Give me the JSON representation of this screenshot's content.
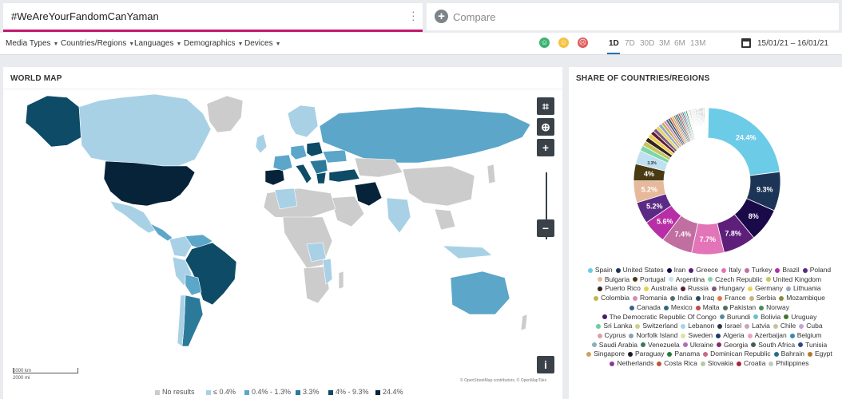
{
  "query": {
    "text": "#WeAreYourFandomCanYaman"
  },
  "compare": {
    "label": "Compare"
  },
  "filters": [
    {
      "label": "Media Types"
    },
    {
      "label": "Countries/Regions"
    },
    {
      "label": "Languages"
    },
    {
      "label": "Demographics"
    },
    {
      "label": "Devices"
    }
  ],
  "sentiments": [
    {
      "name": "positive",
      "color": "#3cb371",
      "glyph": "☺"
    },
    {
      "name": "neutral",
      "color": "#f5c242",
      "glyph": "☺"
    },
    {
      "name": "negative",
      "color": "#e05a5a",
      "glyph": "☹"
    }
  ],
  "ranges": [
    "1D",
    "7D",
    "30D",
    "3M",
    "6M",
    "13M"
  ],
  "active_range": "1D",
  "date_range": "15/01/21 – 16/01/21",
  "world_map": {
    "title": "WORLD MAP",
    "scale_km": "5000 km",
    "scale_mi": "2000 mi",
    "attribution": "© OpenStreetMap contributors, © OpenMapTiles",
    "legend": [
      {
        "label": "No results",
        "color": "#cccccc"
      },
      {
        "label": "≤ 0.4%",
        "color": "#a8d1e6"
      },
      {
        "label": "0.4% - 1.3%",
        "color": "#5ba6c9"
      },
      {
        "label": "3.3%",
        "color": "#2b7a9a"
      },
      {
        "label": "4% - 9.3%",
        "color": "#0d4b66"
      },
      {
        "label": "24.4%",
        "color": "#06233a"
      }
    ]
  },
  "share": {
    "title": "SHARE OF COUNTRIES/REGIONS"
  },
  "chart_data": {
    "type": "pie",
    "title": "SHARE OF COUNTRIES/REGIONS",
    "donut": true,
    "series": [
      {
        "name": "Spain",
        "value": 24.4,
        "label": "24.4%",
        "color": "#6ccbe7"
      },
      {
        "name": "United States",
        "value": 9.3,
        "label": "9.3%",
        "color": "#1c3557"
      },
      {
        "name": "Iran",
        "value": 8,
        "label": "8%",
        "color": "#1a0a4a"
      },
      {
        "name": "Greece",
        "value": 7.8,
        "label": "7.8%",
        "color": "#5e1f7a"
      },
      {
        "name": "Italy",
        "value": 7.7,
        "label": "7.7%",
        "color": "#e374b8"
      },
      {
        "name": "Turkey",
        "value": 7.4,
        "label": "7.4%",
        "color": "#c06fa0"
      },
      {
        "name": "Brazil",
        "value": 5.6,
        "label": "5.6%",
        "color": "#b82ea6"
      },
      {
        "name": "Poland",
        "value": 5.2,
        "label": "5.2%",
        "color": "#5b2a85"
      },
      {
        "name": "Bulgaria",
        "value": 5.2,
        "label": "5.2%",
        "color": "#e6b99a"
      },
      {
        "name": "Portugal",
        "value": 4,
        "label": "4%",
        "color": "#4a3a14"
      },
      {
        "name": "Argentina",
        "value": 3.3,
        "label": "3.3%",
        "color": "#bfe0f0"
      },
      {
        "name": "Czech Republic",
        "value": 1.3,
        "label": "",
        "color": "#7ed6a8"
      },
      {
        "name": "United Kingdom",
        "value": 1.2,
        "label": "",
        "color": "#c2c760"
      },
      {
        "name": "Puerto Rico",
        "value": 1.1,
        "label": "",
        "color": "#37231a"
      },
      {
        "name": "Australia",
        "value": 1,
        "label": "",
        "color": "#e8d04a"
      },
      {
        "name": "Russia",
        "value": 0.9,
        "label": "",
        "color": "#5f1c38"
      },
      {
        "name": "Hungary",
        "value": 0.9,
        "label": "",
        "color": "#7a5a7a"
      },
      {
        "name": "Germany",
        "value": 0.8,
        "label": "",
        "color": "#e6d35a"
      },
      {
        "name": "Lithuania",
        "value": 0.8,
        "label": "",
        "color": "#9aa6c8"
      },
      {
        "name": "Colombia",
        "value": 0.7,
        "label": "",
        "color": "#c3b54a"
      },
      {
        "name": "Romania",
        "value": 0.6,
        "label": "",
        "color": "#d88ab8"
      },
      {
        "name": "India",
        "value": 0.6,
        "label": "",
        "color": "#566b75"
      },
      {
        "name": "Iraq",
        "value": 0.5,
        "label": "",
        "color": "#2a4a66"
      },
      {
        "name": "France",
        "value": 0.5,
        "label": "",
        "color": "#e8734a"
      },
      {
        "name": "Serbia",
        "value": 0.5,
        "label": "",
        "color": "#c8b27a"
      },
      {
        "name": "Mozambique",
        "value": 0.4,
        "label": "",
        "color": "#8a8a3a"
      },
      {
        "name": "Canada",
        "value": 0.4,
        "label": "",
        "color": "#3b5f8a"
      },
      {
        "name": "Mexico",
        "value": 0.4,
        "label": "",
        "color": "#2f6a7a"
      },
      {
        "name": "Malta",
        "value": 0.4,
        "label": "",
        "color": "#c24a4a"
      },
      {
        "name": "Pakistan",
        "value": 0.3,
        "label": "",
        "color": "#4e6e5a"
      },
      {
        "name": "Norway",
        "value": 0.3,
        "label": "",
        "color": "#4a8a5a"
      },
      {
        "name": "The Democratic Republic Of Congo",
        "value": 0.3,
        "label": "",
        "color": "#4a1a6a"
      },
      {
        "name": "Burundi",
        "value": 0.3,
        "label": "",
        "color": "#5a8aa0"
      },
      {
        "name": "Bolivia",
        "value": 0.3,
        "label": "",
        "color": "#6ac0c8"
      },
      {
        "name": "Uruguay",
        "value": 0.3,
        "label": "",
        "color": "#3a7a2a"
      },
      {
        "name": "Sri Lanka",
        "value": 0.2,
        "label": "",
        "color": "#6acf9a"
      },
      {
        "name": "Switzerland",
        "value": 0.2,
        "label": "",
        "color": "#c8d08a"
      },
      {
        "name": "Lebanon",
        "value": 0.2,
        "label": "",
        "color": "#a0d8e0"
      },
      {
        "name": "Israel",
        "value": 0.2,
        "label": "",
        "color": "#2a3a4a"
      },
      {
        "name": "Latvia",
        "value": 0.2,
        "label": "",
        "color": "#c8a0c0"
      },
      {
        "name": "Chile",
        "value": 0.2,
        "label": "",
        "color": "#c8c0a0"
      },
      {
        "name": "Cuba",
        "value": 0.2,
        "label": "",
        "color": "#c8a0d8"
      },
      {
        "name": "Cyprus",
        "value": 0.2,
        "label": "",
        "color": "#e0a0a0"
      },
      {
        "name": "Norfolk Island",
        "value": 0.2,
        "label": "",
        "color": "#8aa0b0"
      },
      {
        "name": "Sweden",
        "value": 0.2,
        "label": "",
        "color": "#e0e0a0"
      },
      {
        "name": "Algeria",
        "value": 0.2,
        "label": "",
        "color": "#1a3a6a"
      },
      {
        "name": "Azerbaijan",
        "value": 0.2,
        "label": "",
        "color": "#e8a0c8"
      },
      {
        "name": "Belgium",
        "value": 0.2,
        "label": "",
        "color": "#3a8ab0"
      },
      {
        "name": "Saudi Arabia",
        "value": 0.2,
        "label": "",
        "color": "#8ab0b8"
      },
      {
        "name": "Venezuela",
        "value": 0.2,
        "label": "",
        "color": "#3a7a5a"
      },
      {
        "name": "Ukraine",
        "value": 0.2,
        "label": "",
        "color": "#b070b0"
      },
      {
        "name": "Georgia",
        "value": 0.2,
        "label": "",
        "color": "#8a2a6a"
      },
      {
        "name": "South Africa",
        "value": 0.2,
        "label": "",
        "color": "#4a5a5a"
      },
      {
        "name": "Tunisia",
        "value": 0.2,
        "label": "",
        "color": "#2a4a8a"
      },
      {
        "name": "Singapore",
        "value": 0.2,
        "label": "",
        "color": "#d0a060"
      },
      {
        "name": "Paraguay",
        "value": 0.2,
        "label": "",
        "color": "#1a1a2a"
      },
      {
        "name": "Panama",
        "value": 0.1,
        "label": "",
        "color": "#2a7a3a"
      },
      {
        "name": "Dominican Republic",
        "value": 0.1,
        "label": "",
        "color": "#c86a8a"
      },
      {
        "name": "Bahrain",
        "value": 0.1,
        "label": "",
        "color": "#2a6a8a"
      },
      {
        "name": "Egypt",
        "value": 0.1,
        "label": "",
        "color": "#b07a2a"
      },
      {
        "name": "Netherlands",
        "value": 0.1,
        "label": "",
        "color": "#8a3a9a"
      },
      {
        "name": "Costa Rica",
        "value": 0.1,
        "label": "",
        "color": "#c8503a"
      },
      {
        "name": "Slovakia",
        "value": 0.1,
        "label": "",
        "color": "#b8c8a0"
      },
      {
        "name": "Croatia",
        "value": 0.1,
        "label": "",
        "color": "#b0203a"
      },
      {
        "name": "Philippines",
        "value": 0.1,
        "label": "",
        "color": "#c0c8c0"
      }
    ]
  }
}
